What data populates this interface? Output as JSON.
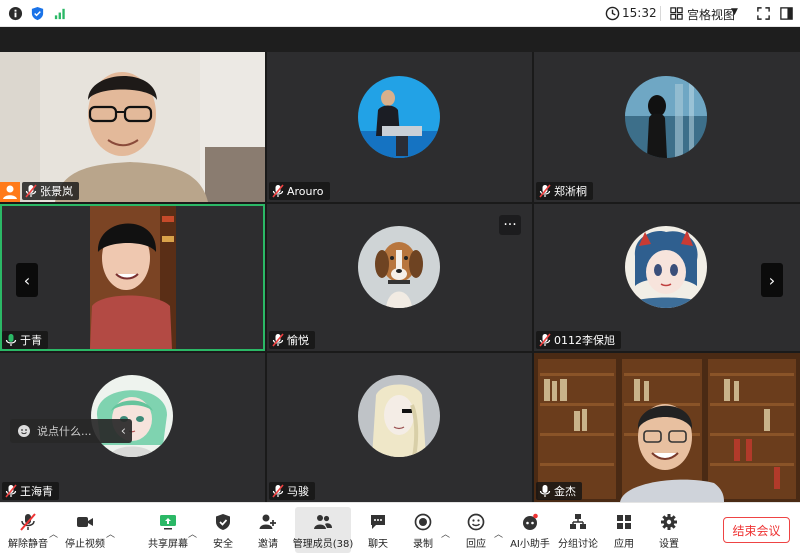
{
  "topbar": {
    "time": "15:32",
    "view_label": "宫格视图"
  },
  "participants": [
    {
      "name": "张景岚",
      "host": true
    },
    {
      "name": "Arouro"
    },
    {
      "name": "郑淅桐"
    },
    {
      "name": "于青",
      "speaking": true
    },
    {
      "name": "愉悦"
    },
    {
      "name": "0112李保旭"
    },
    {
      "name": "王海青"
    },
    {
      "name": "马骏"
    },
    {
      "name": "金杰"
    }
  ],
  "chat": {
    "placeholder": "说点什么..."
  },
  "toolbar": {
    "unmute": "解除静音",
    "stop_video": "停止视频",
    "share_screen": "共享屏幕",
    "security": "安全",
    "invite": "邀请",
    "manage_members": "管理成员(38)",
    "chat": "聊天",
    "record": "录制",
    "reactions": "回应",
    "ai_assistant": "AI小助手",
    "breakout": "分组讨论",
    "apps": "应用",
    "settings": "设置",
    "end_meeting": "结束会议"
  },
  "colors": {
    "speaking_border": "#2bb866",
    "host_badge": "#ff7a1a",
    "end_button": "#e33333",
    "tile_bg": "#2d2d2f"
  }
}
